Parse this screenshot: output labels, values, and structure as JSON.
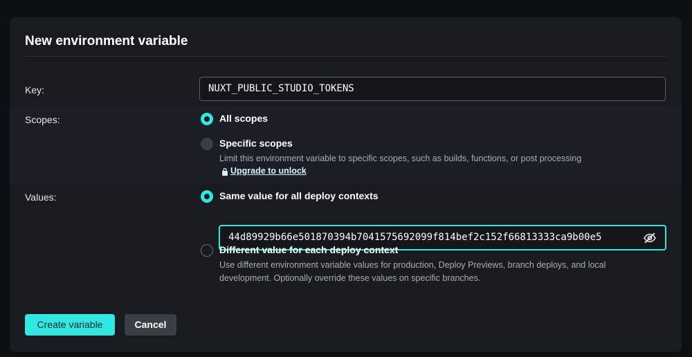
{
  "dialog": {
    "title": "New environment variable"
  },
  "key": {
    "label": "Key:",
    "value": "NUXT_PUBLIC_STUDIO_TOKENS"
  },
  "scopes": {
    "label": "Scopes:",
    "all_scopes": {
      "label": "All scopes",
      "selected": true
    },
    "specific_scopes": {
      "label": "Specific scopes",
      "description": "Limit this environment variable to specific scopes, such as builds, functions, or post processing",
      "upgrade_link": "Upgrade to unlock",
      "disabled": true
    }
  },
  "values": {
    "label": "Values:",
    "same_value": {
      "label": "Same value for all deploy contexts",
      "selected": true,
      "value": "44d89929b66e501870394b7041575692099f814bef2c152f66813333ca9b00e5"
    },
    "different_value": {
      "label": "Different value for each deploy context",
      "description_line1": "Use different environment variable values for production, Deploy Previews, branch deploys, and local",
      "description_line2": "development. Optionally override these values on specific branches."
    }
  },
  "actions": {
    "create_label": "Create variable",
    "cancel_label": "Cancel"
  },
  "colors": {
    "accent": "#32e6e2",
    "background": "#181b20",
    "page": "#0b1014"
  },
  "icons": {
    "lock": "lock-icon",
    "visibility": "eye-off-icon"
  }
}
